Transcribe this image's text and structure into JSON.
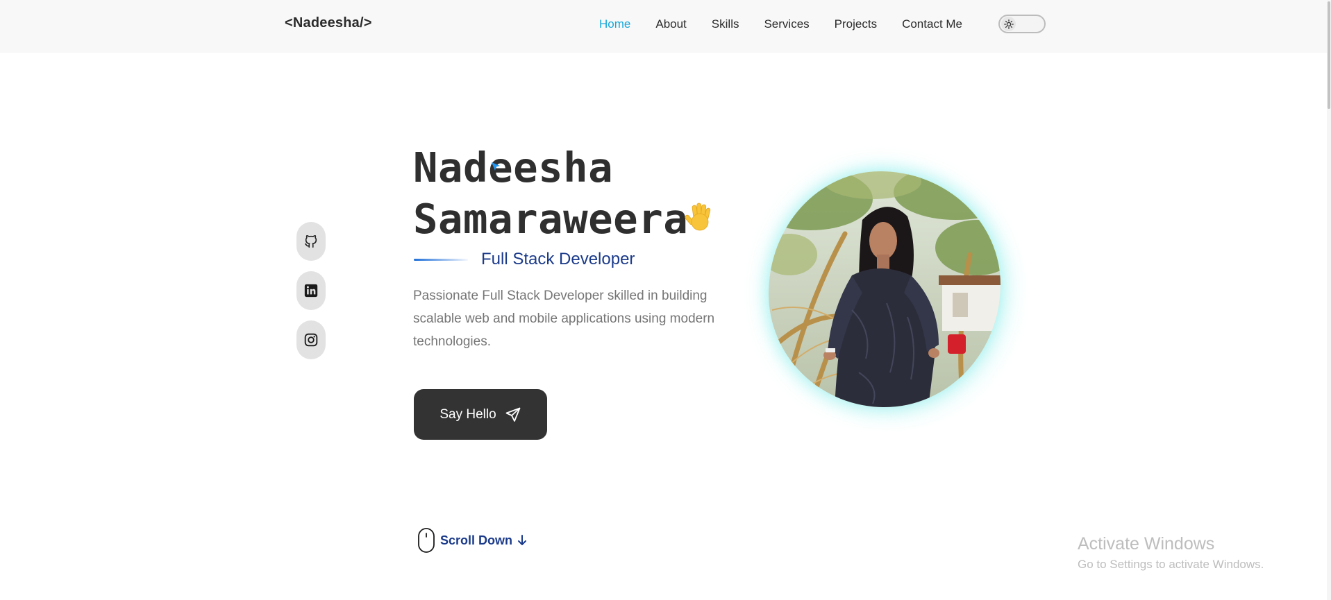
{
  "header": {
    "logo": "<Nadeesha/>",
    "nav": [
      {
        "label": "Home",
        "active": true
      },
      {
        "label": "About",
        "active": false
      },
      {
        "label": "Skills",
        "active": false
      },
      {
        "label": "Services",
        "active": false
      },
      {
        "label": "Projects",
        "active": false
      },
      {
        "label": "Contact Me",
        "active": false
      }
    ],
    "theme_toggle_icon": "sun-icon"
  },
  "socials": [
    {
      "icon": "github-icon"
    },
    {
      "icon": "linkedin-icon"
    },
    {
      "icon": "instagram-icon"
    }
  ],
  "hero": {
    "name_line1": "Nadeesha",
    "name_line2": "Samaraweera",
    "wave_icon": "waving-hand-icon",
    "subtitle": "Full Stack Developer",
    "description": "Passionate Full Stack Developer skilled in building scalable web and mobile applications using modern technologies.",
    "button_label": "Say Hello",
    "button_icon": "paper-plane-icon",
    "photo": "profile-photo"
  },
  "scroll": {
    "label": "Scroll Down",
    "icon": "mouse-icon"
  },
  "watermark": {
    "title": "Activate Windows",
    "subtitle": "Go to Settings to activate Windows."
  },
  "colors": {
    "accent": "#17a7d8",
    "subtitle": "#1a3a8a",
    "button": "#333333",
    "glow": "#78ece6"
  }
}
